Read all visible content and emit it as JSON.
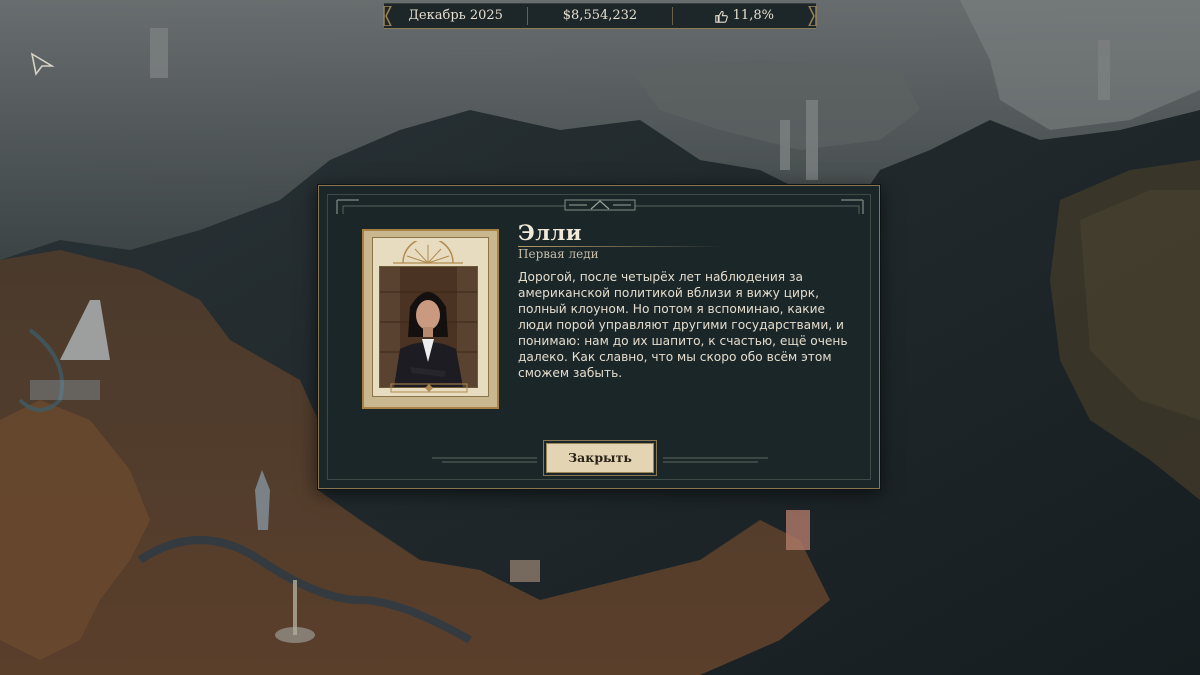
{
  "topbar": {
    "date": "Декабрь 2025",
    "money": "$8,554,232",
    "approval": "11,8%",
    "approval_icon": "thumbs-up-icon"
  },
  "dialog": {
    "name": "Элли",
    "subtitle": "Первая леди",
    "message": "Дорогой, после четырёх лет наблюдения за американской политикой вблизи я вижу цирк, полный клоуном. Но потом я вспоминаю, какие люди порой управляют другими государствами, и понимаю: нам до их шапито, к счастью, ещё очень далеко. Как славно, что мы скоро обо всём этом сможем забыть.",
    "close_label": "Закрыть"
  },
  "colors": {
    "panel": "#1b2629",
    "gold": "#8a7553",
    "button": "#e3d5b4",
    "text": "#e4ddcd"
  }
}
